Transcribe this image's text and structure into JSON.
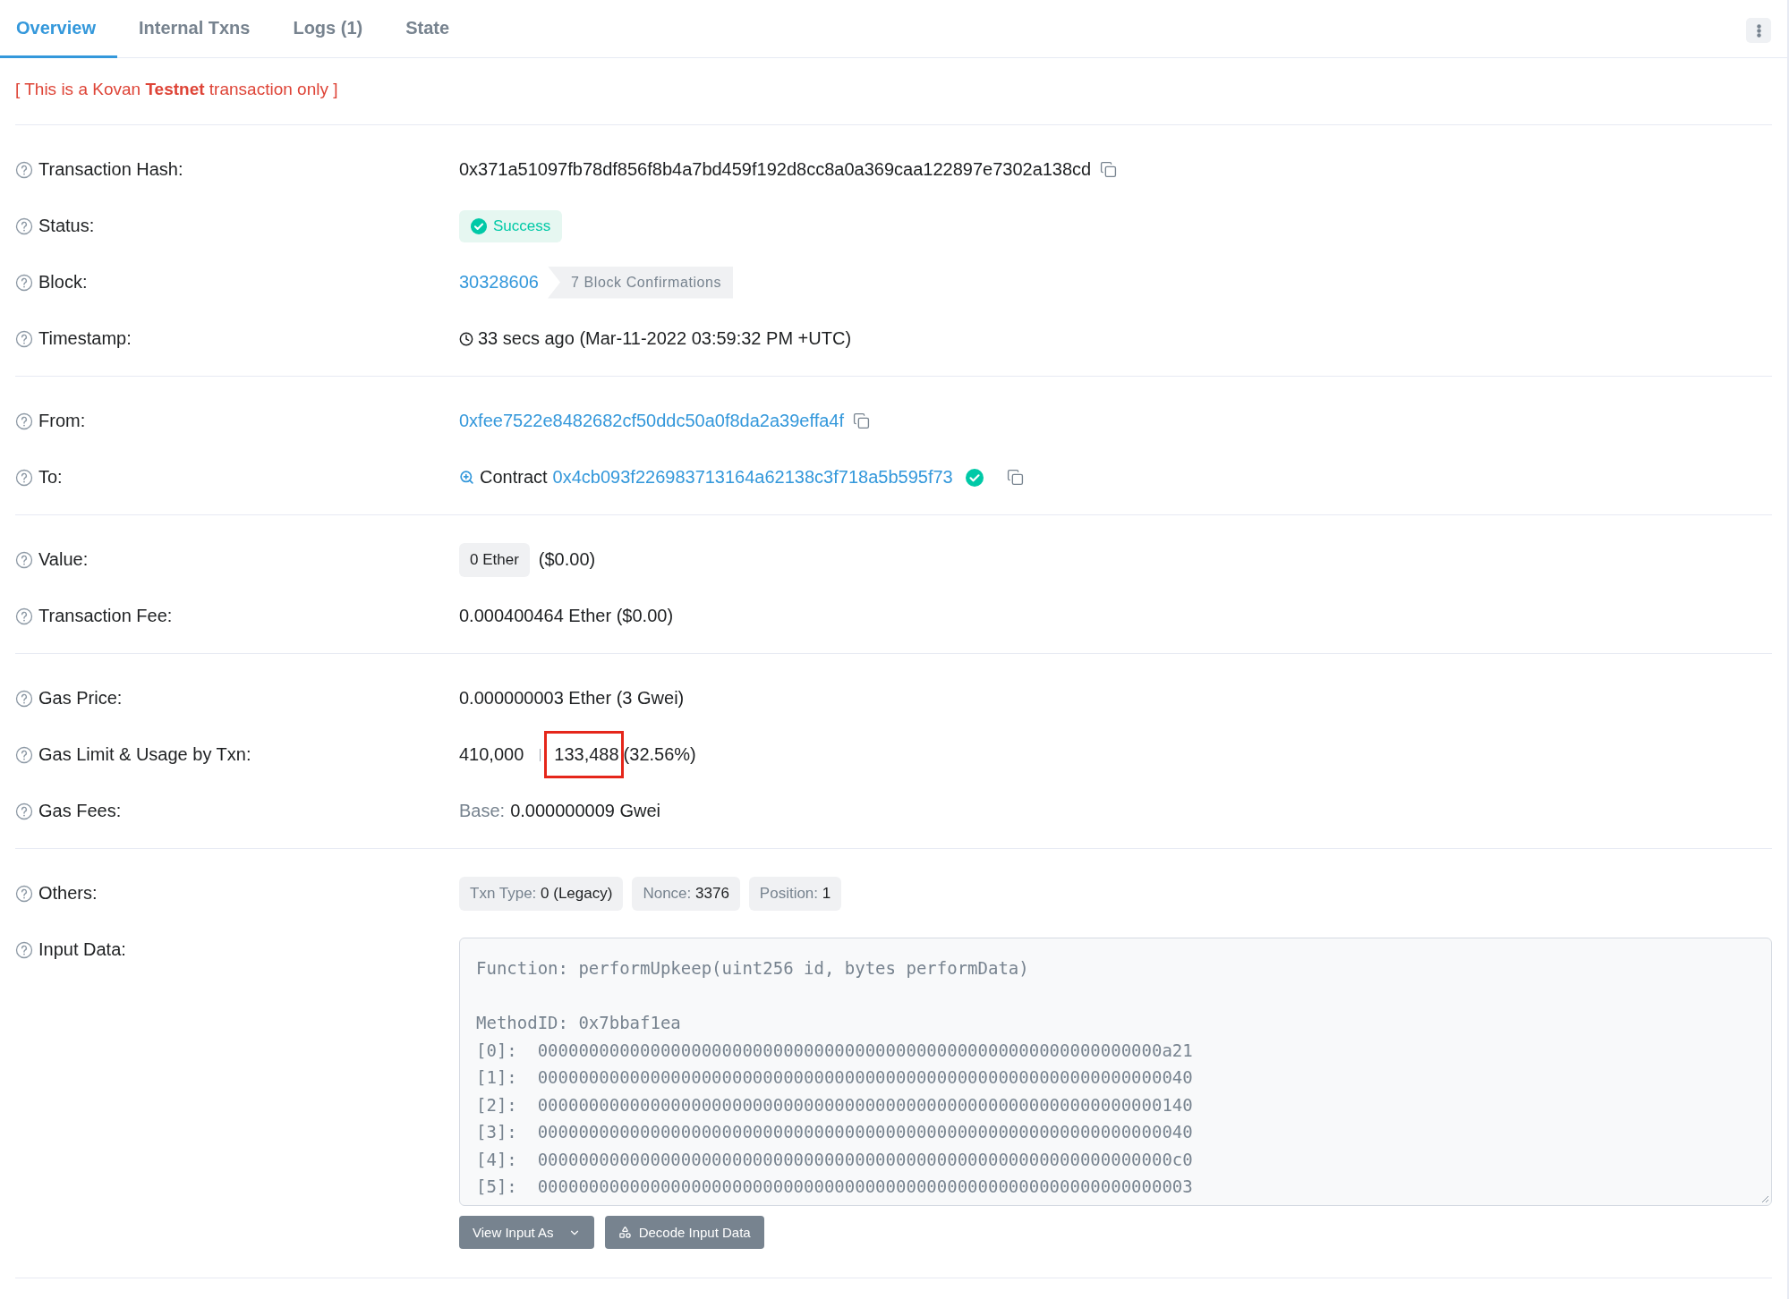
{
  "tabs": [
    {
      "label": "Overview",
      "selected": true
    },
    {
      "label": "Internal Txns",
      "selected": false
    },
    {
      "label": "Logs (1)",
      "selected": false
    },
    {
      "label": "State",
      "selected": false
    }
  ],
  "notice": "[ This is a Kovan **Testnet** transaction only ]",
  "sections": [
    [
      {
        "kind": "hash",
        "label": "Transaction Hash:",
        "value": "0x371a51097fb78df856f8b4a7bd459f192d8cc8a0a369caa122897e7302a138cd"
      },
      {
        "kind": "status",
        "label": "Status:",
        "value": "Success"
      },
      {
        "kind": "block",
        "label": "Block:",
        "value": "30328606",
        "confirmations": "7 Block Confirmations"
      },
      {
        "kind": "timestamp",
        "label": "Timestamp:",
        "value": "33 secs ago (Mar-11-2022 03:59:32 PM +UTC)"
      }
    ],
    [
      {
        "kind": "address",
        "label": "From:",
        "value": "0xfee7522e8482682cf50ddc50a0f8da2a39effa4f"
      },
      {
        "kind": "contract",
        "label": "To:",
        "prefix": "Contract",
        "value": "0x4cb093f226983713164a62138c3f718a5b595f73",
        "verified": true
      }
    ],
    [
      {
        "kind": "value",
        "label": "Value:",
        "amount": "0 Ether",
        "usd": "($0.00)"
      },
      {
        "kind": "text",
        "label": "Transaction Fee:",
        "value": "0.000400464 Ether ($0.00)"
      }
    ],
    [
      {
        "kind": "text",
        "label": "Gas Price:",
        "value": "0.000000003 Ether (3 Gwei)"
      },
      {
        "kind": "gas_usage",
        "label": "Gas Limit & Usage by Txn:",
        "limit": "410,000",
        "used": "133,488",
        "percent": "(32.56%)",
        "highlighted": true
      },
      {
        "kind": "base",
        "label": "Gas Fees:",
        "key": "Base:",
        "value": "0.000000009 Gwei"
      }
    ],
    [
      {
        "kind": "chips",
        "label": "Others:",
        "chips": [
          {
            "key": "Txn Type:",
            "value": "0 (Legacy)"
          },
          {
            "key": "Nonce:",
            "value": "3376"
          },
          {
            "key": "Position:",
            "value": "1"
          }
        ]
      },
      {
        "kind": "input",
        "label": "Input Data:",
        "lines": [
          "Function: performUpkeep(uint256 id, bytes performData)",
          "MethodID: 0x7bbaf1ea",
          "[0]:  0000000000000000000000000000000000000000000000000000000000000a21",
          "[1]:  0000000000000000000000000000000000000000000000000000000000000040",
          "[2]:  0000000000000000000000000000000000000000000000000000000000000140",
          "[3]:  0000000000000000000000000000000000000000000000000000000000000040",
          "[4]:  00000000000000000000000000000000000000000000000000000000000000c0",
          "[5]:  0000000000000000000000000000000000000000000000000000000000000003"
        ],
        "buttons": [
          {
            "kind": "dropdown",
            "label": "View Input As"
          },
          {
            "kind": "decode",
            "label": "Decode Input Data"
          }
        ]
      }
    ]
  ]
}
